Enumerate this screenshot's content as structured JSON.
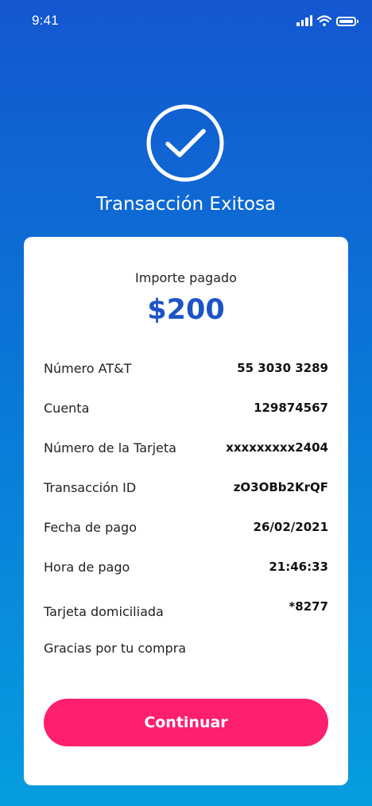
{
  "status_bar": {
    "time": "9:41",
    "icons": [
      "signal-icon",
      "wifi-icon",
      "battery-icon"
    ]
  },
  "header": {
    "icon": "check-circle-icon",
    "title": "Transacción Exitosa"
  },
  "summary": {
    "amount_label": "Importe pagado",
    "amount": "$200"
  },
  "details": [
    {
      "label": "Número AT&T",
      "value": "55 3030 3289"
    },
    {
      "label": "Cuenta",
      "value": "129874567"
    },
    {
      "label": "Número de la Tarjeta",
      "value": "xxxxxxxxx2404"
    },
    {
      "label": "Transacción ID",
      "value": "zO3OBb2KrQF"
    },
    {
      "label": "Fecha de pago",
      "value": "26/02/2021"
    },
    {
      "label": "Hora de pago",
      "value": "21:46:33"
    },
    {
      "label": "Tarjeta domiciliada",
      "value": "*8277"
    }
  ],
  "footer": {
    "thanks": "Gracias por tu compra",
    "continue_label": "Continuar"
  },
  "colors": {
    "background_top": "#1457d1",
    "background_bottom": "#069ddf",
    "amount": "#1c54c6",
    "button": "#ff1f6e"
  }
}
